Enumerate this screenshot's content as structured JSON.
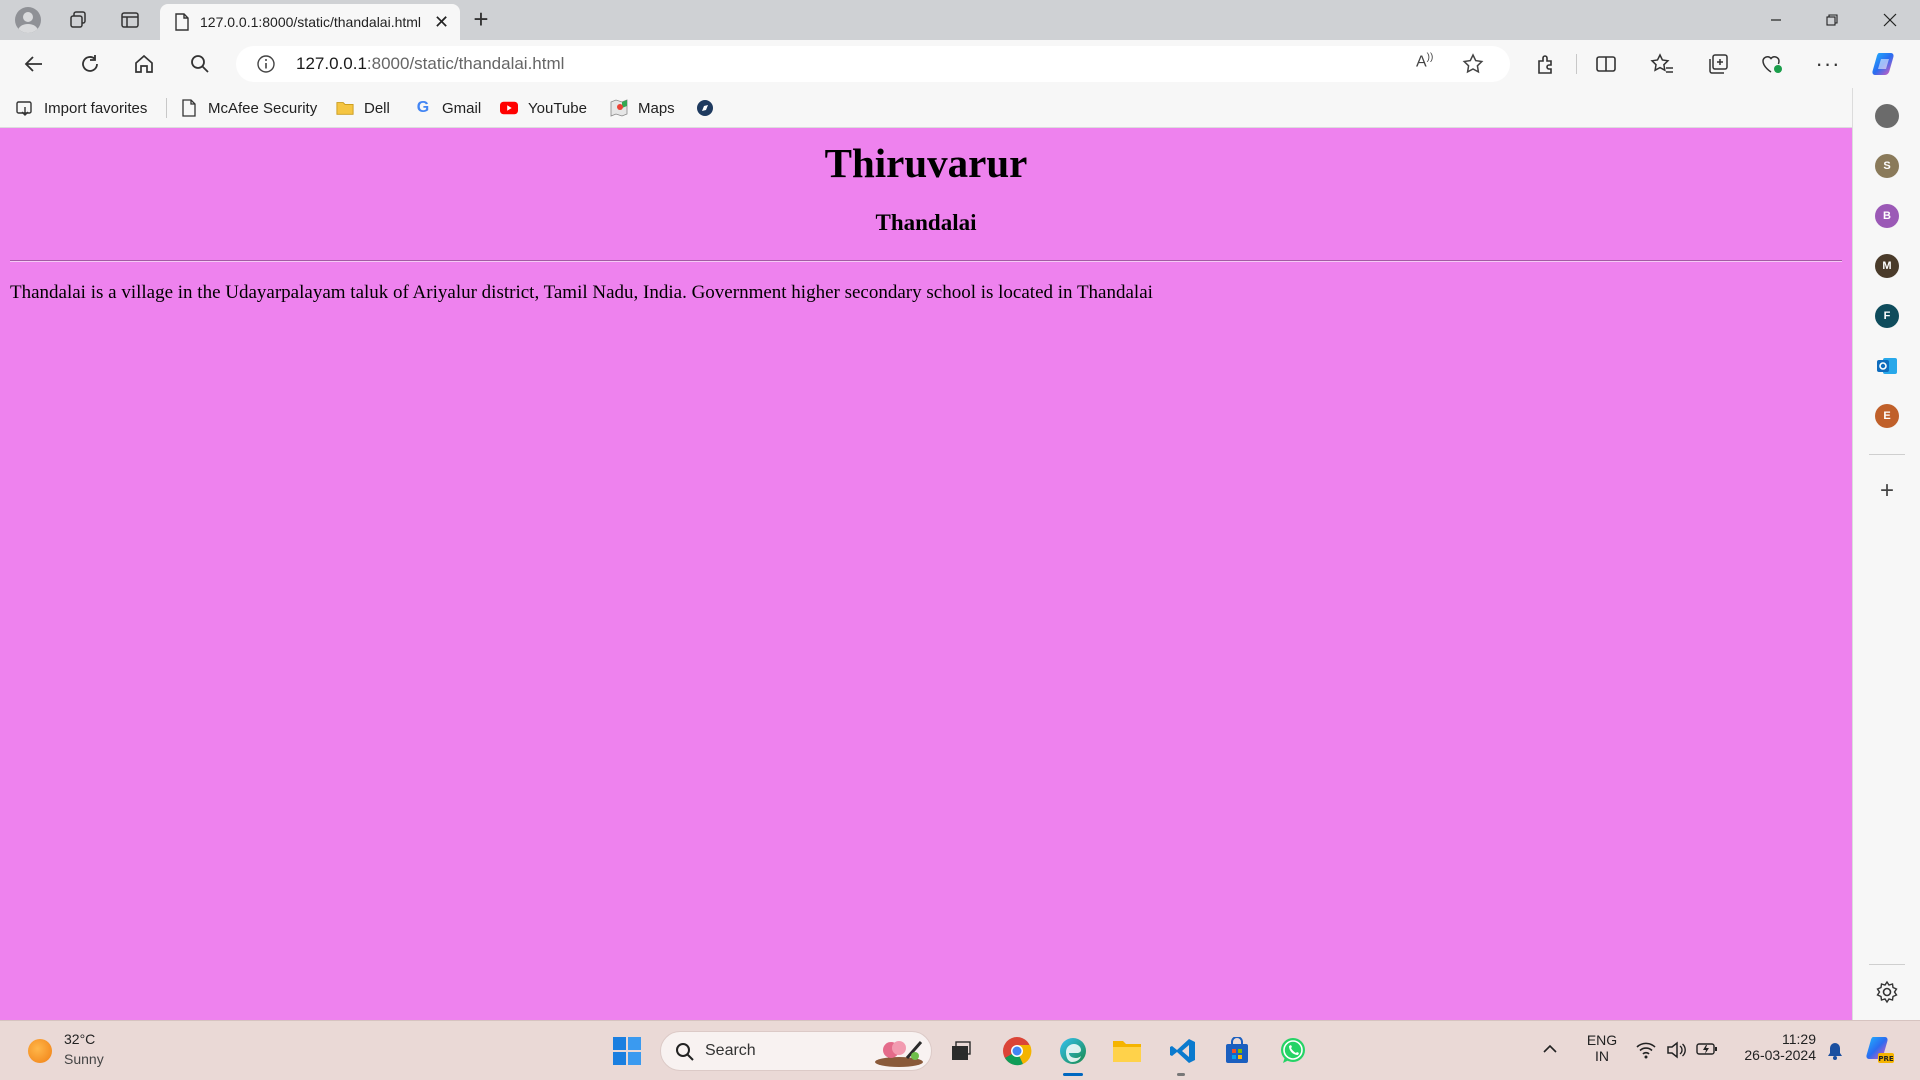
{
  "browser": {
    "tab": {
      "title": "127.0.0.1:8000/static/thandalai.html"
    },
    "address": {
      "host": "127.0.0.1",
      "rest": ":8000/static/thandalai.html"
    },
    "favorites": [
      {
        "label": "Import favorites",
        "icon": "import-icon"
      },
      {
        "label": "McAfee Security",
        "icon": "page-icon"
      },
      {
        "label": "Dell",
        "icon": "folder-icon"
      },
      {
        "label": "Gmail",
        "icon": "google-icon"
      },
      {
        "label": "YouTube",
        "icon": "youtube-icon"
      },
      {
        "label": "Maps",
        "icon": "maps-icon"
      }
    ],
    "sidebar": {
      "avatars": [
        {
          "letter": "",
          "color": "#6b6b6b"
        },
        {
          "letter": "S",
          "color": "#8a7a5a"
        },
        {
          "letter": "B",
          "color": "#9b59b6"
        },
        {
          "letter": "M",
          "color": "#4a3b2a"
        },
        {
          "letter": "F",
          "color": "#0f4c5c"
        },
        {
          "letter": "",
          "color": "#0f6cbd",
          "icon": "outlook-icon"
        },
        {
          "letter": "E",
          "color": "#c0602a"
        }
      ]
    }
  },
  "page": {
    "heading": "Thiruvarur",
    "subheading": "Thandalai",
    "paragraph": "Thandalai is a village in the Udayarpalayam taluk of Ariyalur district, Tamil Nadu, India. Government higher secondary school is located in Thandalai",
    "background": "#ee82ee"
  },
  "taskbar": {
    "weather": {
      "temp": "32°C",
      "desc": "Sunny"
    },
    "search_label": "Search",
    "lang_top": "ENG",
    "lang_bottom": "IN",
    "time": "11:29",
    "date": "26-03-2024"
  }
}
